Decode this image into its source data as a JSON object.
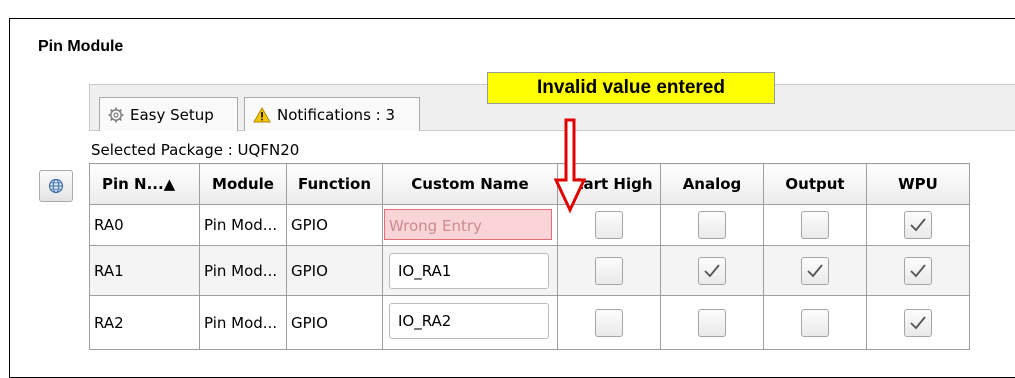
{
  "panel": {
    "title": "Pin Module"
  },
  "tabs": [
    {
      "label": "Easy Setup",
      "icon": "gear-icon"
    },
    {
      "label": "Notifications : 3",
      "icon": "warning-icon"
    }
  ],
  "package_label": "Selected Package : UQFN20",
  "table": {
    "columns": [
      "Pin N...▲",
      "Module",
      "Function",
      "Custom Name",
      "Start High",
      "Analog",
      "Output",
      "WPU"
    ],
    "rows": [
      {
        "pin": "RA0",
        "module": "Pin Mod...",
        "function": "GPIO",
        "custom_name": "Wrong Entry",
        "start_high": false,
        "analog": false,
        "output": false,
        "wpu": true
      },
      {
        "pin": "RA1",
        "module": "Pin Mod...",
        "function": "GPIO",
        "custom_name": "IO_RA1",
        "start_high": false,
        "analog": true,
        "output": true,
        "wpu": true
      },
      {
        "pin": "RA2",
        "module": "Pin Mod...",
        "function": "GPIO",
        "custom_name": "IO_RA2",
        "start_high": false,
        "analog": false,
        "output": false,
        "wpu": true
      }
    ]
  },
  "callout": {
    "text": "Invalid value entered",
    "color": "#ffff00"
  },
  "colors": {
    "error_fill": "#fbd4d8",
    "error_border": "#e56d7a",
    "arrow": "#e00000"
  }
}
